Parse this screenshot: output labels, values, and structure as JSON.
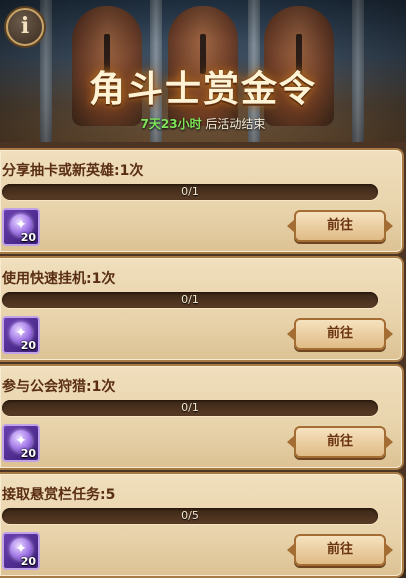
{
  "banner": {
    "title": "角斗士赏金令",
    "time_left": "7天23小时",
    "time_suffix": " 后活动结束",
    "info_icon": "info-icon"
  },
  "quests": [
    {
      "title": "分享抽卡或新英雄:1次",
      "progress": "0/1",
      "progress_fraction": 0,
      "reward_icon": "purple-gem-icon",
      "reward_qty": "20",
      "button_label": "前往"
    },
    {
      "title": "使用快速挂机:1次",
      "progress": "0/1",
      "progress_fraction": 0,
      "reward_icon": "purple-gem-icon",
      "reward_qty": "20",
      "button_label": "前往"
    },
    {
      "title": "参与公会狩猎:1次",
      "progress": "0/1",
      "progress_fraction": 0,
      "reward_icon": "purple-gem-icon",
      "reward_qty": "20",
      "button_label": "前往"
    },
    {
      "title": "接取悬赏栏任务:5",
      "progress": "0/5",
      "progress_fraction": 0,
      "reward_icon": "purple-gem-icon",
      "reward_qty": "20",
      "button_label": "前往"
    }
  ],
  "colors": {
    "title_glow": "#c57a22",
    "time_green": "#7ee55a",
    "card_bg": "#e8d3ab",
    "reward_purple": "#6a3fb0"
  }
}
